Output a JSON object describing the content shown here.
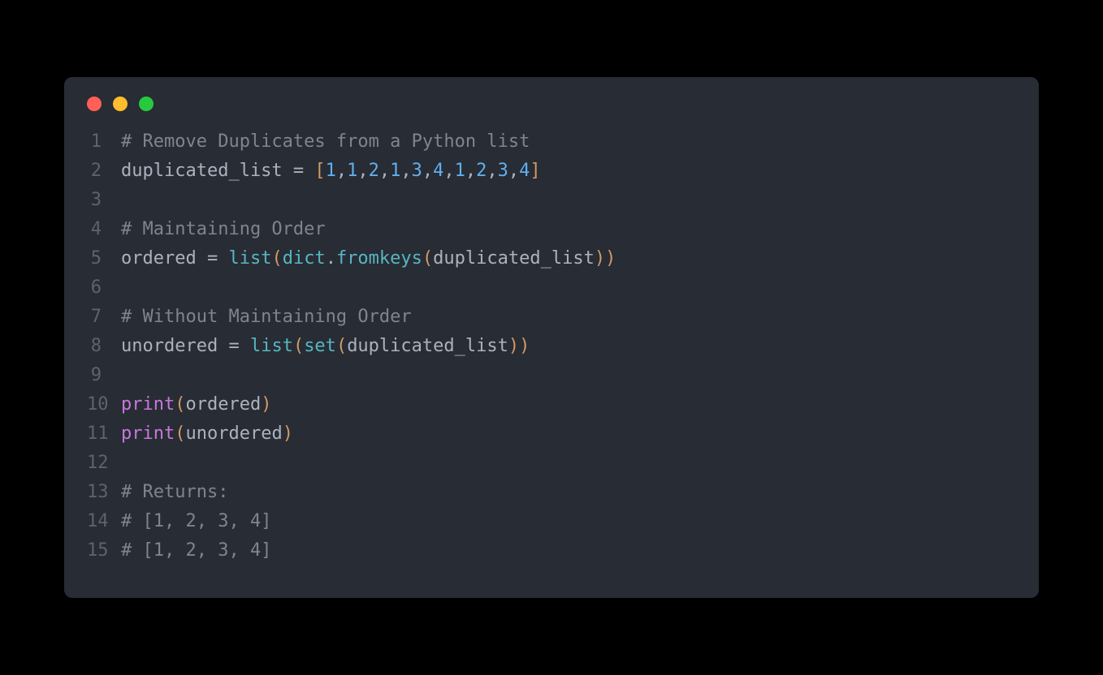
{
  "window": {
    "dots": [
      "red",
      "yellow",
      "green"
    ]
  },
  "colors": {
    "background": "#282c34",
    "comment": "#7f848e",
    "identifier": "#abb2bf",
    "number": "#61afef",
    "bracket": "#d19a66",
    "function_teal": "#56b6c2",
    "keyword_purple": "#c678dd",
    "lineno": "#5c6370"
  },
  "code": {
    "lines": [
      {
        "n": "1",
        "tokens": [
          {
            "t": "# Remove Duplicates from a Python list",
            "c": "comment"
          }
        ]
      },
      {
        "n": "2",
        "tokens": [
          {
            "t": "duplicated_list ",
            "c": "ident"
          },
          {
            "t": "=",
            "c": "op"
          },
          {
            "t": " ",
            "c": "ident"
          },
          {
            "t": "[",
            "c": "bracket"
          },
          {
            "t": "1",
            "c": "number"
          },
          {
            "t": ",",
            "c": "punct"
          },
          {
            "t": "1",
            "c": "number"
          },
          {
            "t": ",",
            "c": "punct"
          },
          {
            "t": "2",
            "c": "number"
          },
          {
            "t": ",",
            "c": "punct"
          },
          {
            "t": "1",
            "c": "number"
          },
          {
            "t": ",",
            "c": "punct"
          },
          {
            "t": "3",
            "c": "number"
          },
          {
            "t": ",",
            "c": "punct"
          },
          {
            "t": "4",
            "c": "number"
          },
          {
            "t": ",",
            "c": "punct"
          },
          {
            "t": "1",
            "c": "number"
          },
          {
            "t": ",",
            "c": "punct"
          },
          {
            "t": "2",
            "c": "number"
          },
          {
            "t": ",",
            "c": "punct"
          },
          {
            "t": "3",
            "c": "number"
          },
          {
            "t": ",",
            "c": "punct"
          },
          {
            "t": "4",
            "c": "number"
          },
          {
            "t": "]",
            "c": "bracket"
          }
        ]
      },
      {
        "n": "3",
        "tokens": [
          {
            "t": "",
            "c": "ident"
          }
        ]
      },
      {
        "n": "4",
        "tokens": [
          {
            "t": "# Maintaining Order",
            "c": "comment"
          }
        ]
      },
      {
        "n": "5",
        "tokens": [
          {
            "t": "ordered ",
            "c": "ident"
          },
          {
            "t": "=",
            "c": "op"
          },
          {
            "t": " ",
            "c": "ident"
          },
          {
            "t": "list",
            "c": "call-list"
          },
          {
            "t": "(",
            "c": "bracket"
          },
          {
            "t": "dict",
            "c": "call-dict"
          },
          {
            "t": ".",
            "c": "punct"
          },
          {
            "t": "fromkeys",
            "c": "call-fromkeys"
          },
          {
            "t": "(",
            "c": "bracket"
          },
          {
            "t": "duplicated_list",
            "c": "ident"
          },
          {
            "t": ")",
            "c": "bracket"
          },
          {
            "t": ")",
            "c": "bracket"
          }
        ]
      },
      {
        "n": "6",
        "tokens": [
          {
            "t": "",
            "c": "ident"
          }
        ]
      },
      {
        "n": "7",
        "tokens": [
          {
            "t": "# Without Maintaining Order",
            "c": "comment"
          }
        ]
      },
      {
        "n": "8",
        "tokens": [
          {
            "t": "unordered ",
            "c": "ident"
          },
          {
            "t": "=",
            "c": "op"
          },
          {
            "t": " ",
            "c": "ident"
          },
          {
            "t": "list",
            "c": "call-list"
          },
          {
            "t": "(",
            "c": "bracket"
          },
          {
            "t": "set",
            "c": "call-set"
          },
          {
            "t": "(",
            "c": "bracket"
          },
          {
            "t": "duplicated_list",
            "c": "ident"
          },
          {
            "t": ")",
            "c": "bracket"
          },
          {
            "t": ")",
            "c": "bracket"
          }
        ]
      },
      {
        "n": "9",
        "tokens": [
          {
            "t": "",
            "c": "ident"
          }
        ]
      },
      {
        "n": "10",
        "tokens": [
          {
            "t": "print",
            "c": "call-print"
          },
          {
            "t": "(",
            "c": "bracket"
          },
          {
            "t": "ordered",
            "c": "ident"
          },
          {
            "t": ")",
            "c": "bracket"
          }
        ]
      },
      {
        "n": "11",
        "tokens": [
          {
            "t": "print",
            "c": "call-print"
          },
          {
            "t": "(",
            "c": "bracket"
          },
          {
            "t": "unordered",
            "c": "ident"
          },
          {
            "t": ")",
            "c": "bracket"
          }
        ]
      },
      {
        "n": "12",
        "tokens": [
          {
            "t": "",
            "c": "ident"
          }
        ]
      },
      {
        "n": "13",
        "tokens": [
          {
            "t": "# Returns:",
            "c": "comment"
          }
        ]
      },
      {
        "n": "14",
        "tokens": [
          {
            "t": "# [1, 2, 3, 4]",
            "c": "comment"
          }
        ]
      },
      {
        "n": "15",
        "tokens": [
          {
            "t": "# [1, 2, 3, 4]",
            "c": "comment"
          }
        ]
      }
    ]
  }
}
